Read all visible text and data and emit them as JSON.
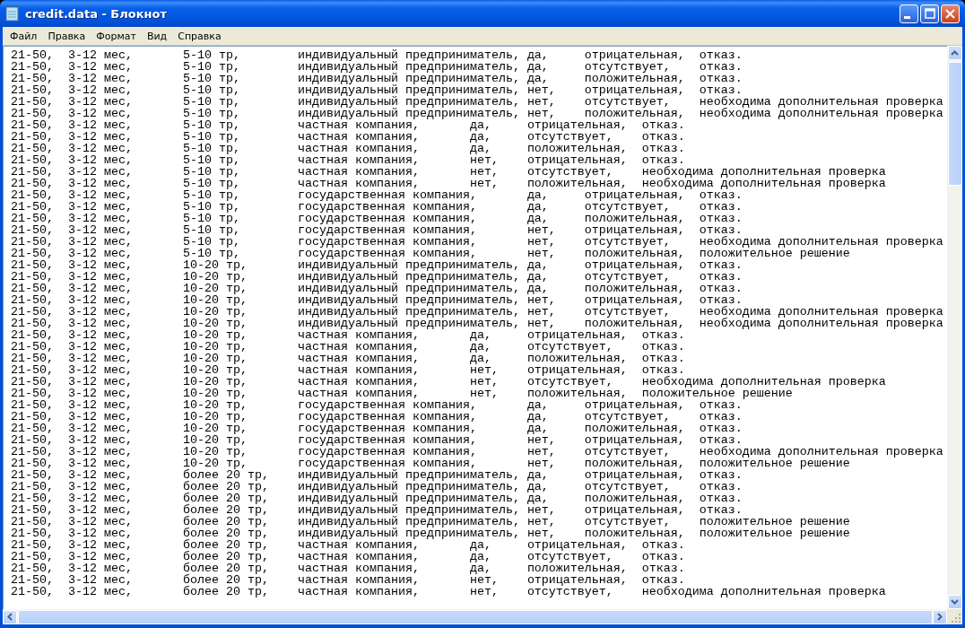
{
  "window": {
    "title": "credit.data - Блокнот"
  },
  "menu": [
    "Файл",
    "Правка",
    "Формат",
    "Вид",
    "Справка"
  ],
  "document": {
    "lines": [
      "21-50,\t3-12 мес,\t5-10 тр,\tиндивидуальный предприниматель,\tда,\tотрицательная,\tотказ.",
      "21-50,\t3-12 мес,\t5-10 тр,\tиндивидуальный предприниматель,\tда,\tотсутствует,\tотказ.",
      "21-50,\t3-12 мес,\t5-10 тр,\tиндивидуальный предприниматель,\tда,\tположительная,\tотказ.",
      "21-50,\t3-12 мес,\t5-10 тр,\tиндивидуальный предприниматель,\tнет,\tотрицательная,\tотказ.",
      "21-50,\t3-12 мес,\t5-10 тр,\tиндивидуальный предприниматель,\tнет,\tотсутствует,\tнеобходима дополнительная проверка",
      "21-50,\t3-12 мес,\t5-10 тр,\tиндивидуальный предприниматель,\tнет,\tположительная,\tнеобходима дополнительная проверка",
      "21-50,\t3-12 мес,\t5-10 тр,\tчастная компания,\tда,\tотрицательная,\tотказ.",
      "21-50,\t3-12 мес,\t5-10 тр,\tчастная компания,\tда,\tотсутствует,\tотказ.",
      "21-50,\t3-12 мес,\t5-10 тр,\tчастная компания,\tда,\tположительная,\tотказ.",
      "21-50,\t3-12 мес,\t5-10 тр,\tчастная компания,\tнет,\tотрицательная,\tотказ.",
      "21-50,\t3-12 мес,\t5-10 тр,\tчастная компания,\tнет,\tотсутствует,\tнеобходима дополнительная проверка",
      "21-50,\t3-12 мес,\t5-10 тр,\tчастная компания,\tнет,\tположительная,\tнеобходима дополнительная проверка",
      "21-50,\t3-12 мес,\t5-10 тр,\tгосударственная компания,\tда,\tотрицательная,\tотказ.",
      "21-50,\t3-12 мес,\t5-10 тр,\tгосударственная компания,\tда,\tотсутствует,\tотказ.",
      "21-50,\t3-12 мес,\t5-10 тр,\tгосударственная компания,\tда,\tположительная,\tотказ.",
      "21-50,\t3-12 мес,\t5-10 тр,\tгосударственная компания,\tнет,\tотрицательная,\tотказ.",
      "21-50,\t3-12 мес,\t5-10 тр,\tгосударственная компания,\tнет,\tотсутствует,\tнеобходима дополнительная проверка",
      "21-50,\t3-12 мес,\t5-10 тр,\tгосударственная компания,\tнет,\tположительная,\tположительное решение",
      "21-50,\t3-12 мес,\t10-20 тр,\tиндивидуальный предприниматель,\tда,\tотрицательная,\tотказ.",
      "21-50,\t3-12 мес,\t10-20 тр,\tиндивидуальный предприниматель,\tда,\tотсутствует,\tотказ.",
      "21-50,\t3-12 мес,\t10-20 тр,\tиндивидуальный предприниматель,\tда,\tположительная,\tотказ.",
      "21-50,\t3-12 мес,\t10-20 тр,\tиндивидуальный предприниматель,\tнет,\tотрицательная,\tотказ.",
      "21-50,\t3-12 мес,\t10-20 тр,\tиндивидуальный предприниматель,\tнет,\tотсутствует,\tнеобходима дополнительная проверка",
      "21-50,\t3-12 мес,\t10-20 тр,\tиндивидуальный предприниматель,\tнет,\tположительная,\tнеобходима дополнительная проверка",
      "21-50,\t3-12 мес,\t10-20 тр,\tчастная компания,\tда,\tотрицательная,\tотказ.",
      "21-50,\t3-12 мес,\t10-20 тр,\tчастная компания,\tда,\tотсутствует,\tотказ.",
      "21-50,\t3-12 мес,\t10-20 тр,\tчастная компания,\tда,\tположительная,\tотказ.",
      "21-50,\t3-12 мес,\t10-20 тр,\tчастная компания,\tнет,\tотрицательная,\tотказ.",
      "21-50,\t3-12 мес,\t10-20 тр,\tчастная компания,\tнет,\tотсутствует,\tнеобходима дополнительная проверка",
      "21-50,\t3-12 мес,\t10-20 тр,\tчастная компания,\tнет,\tположительная,\tположительное решение",
      "21-50,\t3-12 мес,\t10-20 тр,\tгосударственная компания,\tда,\tотрицательная,\tотказ.",
      "21-50,\t3-12 мес,\t10-20 тр,\tгосударственная компания,\tда,\tотсутствует,\tотказ.",
      "21-50,\t3-12 мес,\t10-20 тр,\tгосударственная компания,\tда,\tположительная,\tотказ.",
      "21-50,\t3-12 мес,\t10-20 тр,\tгосударственная компания,\tнет,\tотрицательная,\tотказ.",
      "21-50,\t3-12 мес,\t10-20 тр,\tгосударственная компания,\tнет,\tотсутствует,\tнеобходима дополнительная проверка",
      "21-50,\t3-12 мес,\t10-20 тр,\tгосударственная компания,\tнет,\tположительная,\tположительное решение",
      "21-50,\t3-12 мес,\tболее 20 тр,\tиндивидуальный предприниматель,\tда,\tотрицательная,\tотказ.",
      "21-50,\t3-12 мес,\tболее 20 тр,\tиндивидуальный предприниматель,\tда,\tотсутствует,\tотказ.",
      "21-50,\t3-12 мес,\tболее 20 тр,\tиндивидуальный предприниматель,\tда,\tположительная,\tотказ.",
      "21-50,\t3-12 мес,\tболее 20 тр,\tиндивидуальный предприниматель,\tнет,\tотрицательная,\tотказ.",
      "21-50,\t3-12 мес,\tболее 20 тр,\tиндивидуальный предприниматель,\tнет,\tотсутствует,\tположительное решение",
      "21-50,\t3-12 мес,\tболее 20 тр,\tиндивидуальный предприниматель,\tнет,\tположительная,\tположительное решение",
      "21-50,\t3-12 мес,\tболее 20 тр,\tчастная компания,\tда,\tотрицательная,\tотказ.",
      "21-50,\t3-12 мес,\tболее 20 тр,\tчастная компания,\tда,\tотсутствует,\tотказ.",
      "21-50,\t3-12 мес,\tболее 20 тр,\tчастная компания,\tда,\tположительная,\tотказ.",
      "21-50,\t3-12 мес,\tболее 20 тр,\tчастная компания,\tнет,\tотрицательная,\tотказ.",
      "21-50,\t3-12 мес,\tболее 20 тр,\tчастная компания,\tнет,\tотсутствует,\tнеобходима дополнительная проверка"
    ]
  }
}
